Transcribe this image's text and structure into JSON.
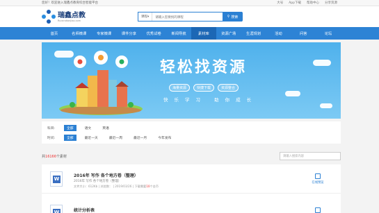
{
  "topbar": {
    "welcome": "您好！欢迎进入瑞鑫点教育综合智能平台",
    "links": [
      "大号",
      "App下载",
      "帮助中心",
      "分享资源"
    ]
  },
  "header": {
    "logo_text": "瑞鑫点教",
    "logo_sub": "Ruixindianjiao.com",
    "search_scope": "课程",
    "search_placeholder": "请输入您要找的课程",
    "search_button": "搜索"
  },
  "nav": {
    "items": [
      "首页",
      "名师微课",
      "专家微课",
      "课件分享",
      "优秀试卷",
      "新闻导航",
      "素材库",
      "资源广场",
      "生涯规划",
      "活动",
      "问答",
      "论坛"
    ],
    "active_index": 6
  },
  "banner": {
    "title": "轻松找资源",
    "tags": [
      "海量资源",
      "快捷下载",
      "资源整合"
    ],
    "slogan": "快乐学习 助你成长"
  },
  "filters": {
    "rows": [
      {
        "label": "科目:",
        "options": [
          "全部",
          "语文",
          "英语"
        ],
        "selected": 0
      },
      {
        "label": "时间:",
        "options": [
          "全部",
          "最近一天",
          "最近一周",
          "最近一月",
          "今年发布"
        ],
        "selected": 0
      }
    ]
  },
  "results": {
    "count_prefix": "共",
    "count": "16166",
    "count_suffix": "个素材",
    "inner_search_placeholder": "请输入搜索内容",
    "items": [
      {
        "title": "2016年 写作 各个地方卷（整理）",
        "desc": "2016年 写作 各个地方卷（整理）",
        "meta_pre": "文件大小：612Kb  |  浏览数：  |  2019/03/26  |  下载需要",
        "meta_num": "10",
        "meta_post": "个金币",
        "preview": "在线预览"
      },
      {
        "title": "统计分析表",
        "desc": "",
        "meta_pre": "",
        "meta_num": "",
        "meta_post": "",
        "preview": "在线预览"
      }
    ]
  },
  "colors": {
    "primary": "#2d83d5",
    "nav_active": "#1c67b5",
    "accent_red": "#e33333"
  }
}
